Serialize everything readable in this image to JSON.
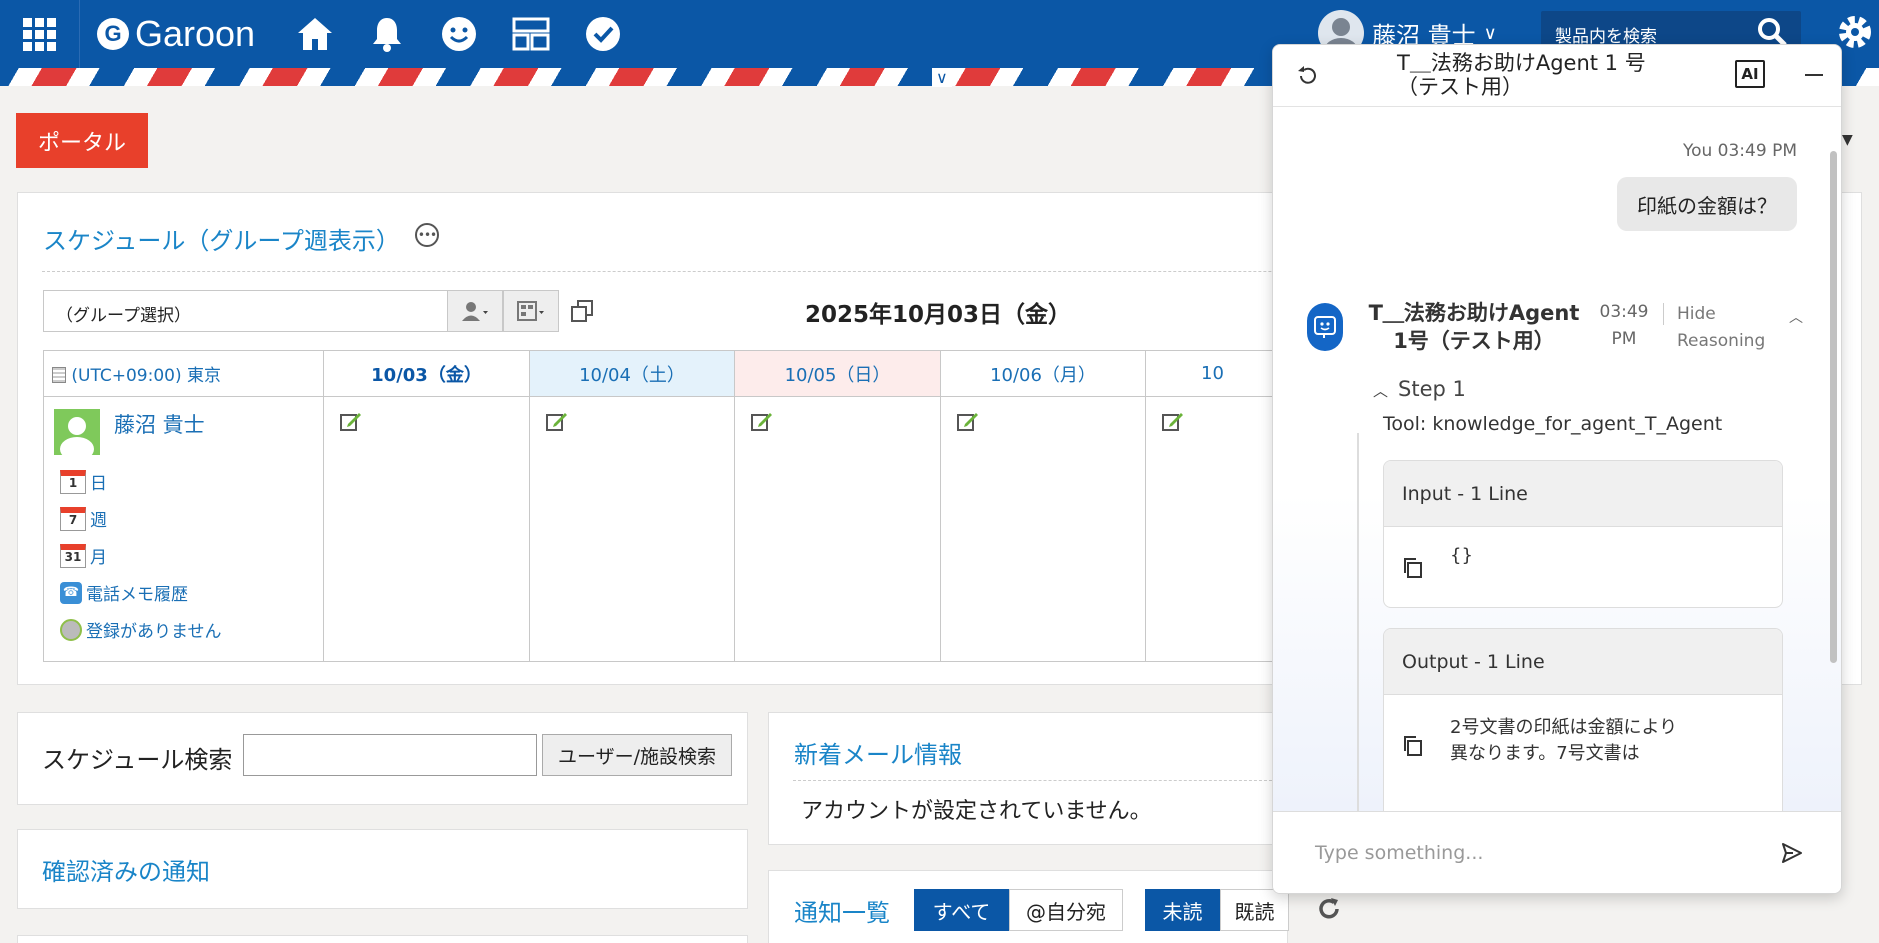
{
  "header": {
    "app_name": "Garoon",
    "logo_letter": "G",
    "user_name": "藤沼 貴士",
    "search_placeholder": "製品内を検索"
  },
  "portal_button": "ポータル",
  "schedule": {
    "title": "スケジュール（グループ週表示）",
    "group_select": "（グループ選択）",
    "date_heading": "2025年10月03日（金）",
    "timezone": "(UTC+09:00) 東京",
    "days": [
      "10/03（金）",
      "10/04（土）",
      "10/05（日）",
      "10/06（月）",
      "10"
    ],
    "person": "藤沼 貴士",
    "links": [
      {
        "icon_text": "1",
        "label": "日"
      },
      {
        "icon_text": "7",
        "label": "週"
      },
      {
        "icon_text": "31",
        "label": "月"
      },
      {
        "label": "電話メモ履歴"
      },
      {
        "label": "登録がありません"
      }
    ]
  },
  "schedule_search": {
    "label": "スケジュール検索",
    "button": "ユーザー/施設検索"
  },
  "confirmed_notifications": {
    "title": "確認済みの通知"
  },
  "new_mail": {
    "title": "新着メール情報",
    "message": "アカウントが設定されていません。"
  },
  "notification_list": {
    "title": "通知一覧",
    "filter_all": "すべて",
    "filter_mention": "@自分宛",
    "filter_unread": "未読",
    "filter_read": "既読"
  },
  "chat": {
    "title": "T＿法務お助けAgent 1 号（テスト用）",
    "ai_badge": "AI",
    "user_time": "You 03:49 PM",
    "user_message": "印紙の金額は？",
    "bot_name": "T＿法務お助けAgent 1号（テスト用）",
    "bot_time": "03:49 PM",
    "hide_reasoning": "Hide Reasoning",
    "step_label": "Step 1",
    "tool_line": "Tool: knowledge_for_agent_T_Agent",
    "input_header": "Input - 1 Line",
    "input_code": "{}",
    "output_header": "Output - 1 Line",
    "output_text_1": "2号文書の印紙は金額により",
    "output_text_2": "異なります。7号文書は",
    "input_placeholder": "Type something..."
  }
}
